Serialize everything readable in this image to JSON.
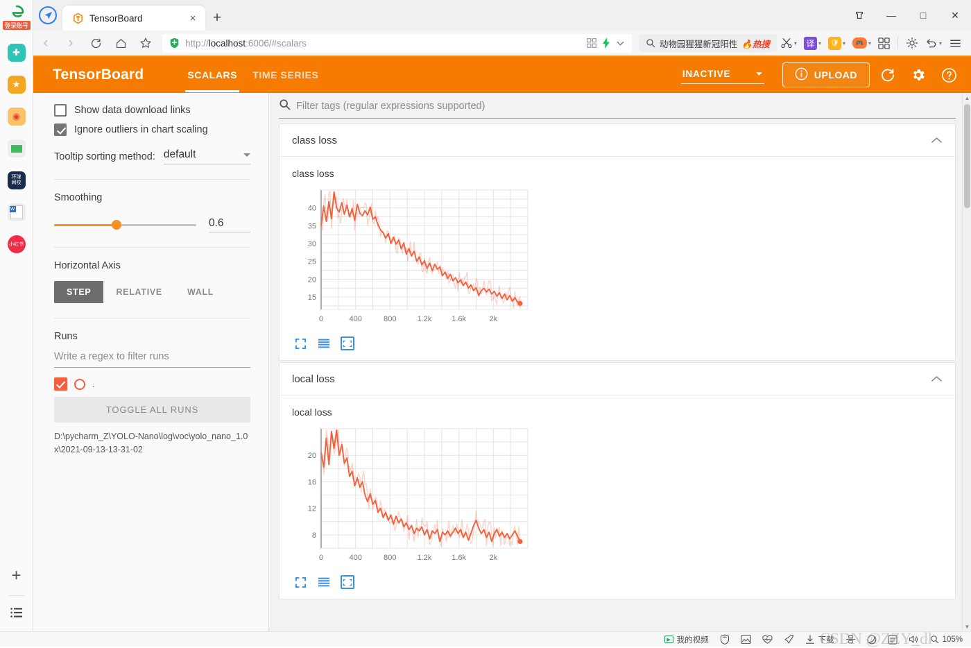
{
  "browser": {
    "tab": {
      "title": "TensorBoard",
      "favicon": "tensorboard-icon",
      "close": "×"
    },
    "newtab_label": "+",
    "window_controls": {
      "restore_group": "☆",
      "minimize": "—",
      "maximize": "□",
      "close": "✕"
    },
    "nav": {
      "back": "‹",
      "forward": "›",
      "reload": "⟳",
      "home": "⌂",
      "bookmark": "☆"
    },
    "address": {
      "scheme": "http://",
      "host": "localhost",
      "rest": ":6006/#scalars",
      "full": "http://localhost:6006/#scalars",
      "security": "shield-icon"
    },
    "omnibox_icons": [
      "qr-code-icon",
      "lightning-icon",
      "chevron-down-icon"
    ],
    "search_pill": {
      "text": "动物园猩猩新冠阳性",
      "badge": "热搜"
    },
    "toolbar_icons": [
      "scissors-icon",
      "translate-icon",
      "shield-rewards-icon",
      "game-icon",
      "apps-grid-icon",
      "brightness-icon",
      "undo-icon",
      "menu-icon"
    ],
    "rail": {
      "logo": "e-browser-logo",
      "login_tag": "登录账号",
      "items": [
        {
          "name": "app-icon-doctor",
          "glyph": "⚕",
          "bg": "#2ec4b6"
        },
        {
          "name": "app-icon-favorites",
          "glyph": "★",
          "bg": "#f5a623"
        },
        {
          "name": "app-icon-weibo",
          "glyph": "◉",
          "bg": "#fbc26a"
        },
        {
          "name": "app-icon-mail",
          "glyph": "✉",
          "bg": "#eeeeee"
        },
        {
          "name": "app-icon-global-net",
          "glyph": "环球",
          "bg": "#1b2b4b"
        },
        {
          "name": "app-icon-word-doc",
          "glyph": "W",
          "bg": "#ededed"
        },
        {
          "name": "app-icon-xiaohongshu",
          "glyph": "小红书",
          "bg": "#f42a48"
        }
      ],
      "add": "+",
      "list": "list-icon"
    },
    "statusbar": {
      "my_video": "我的视频",
      "download": "下载",
      "icons": [
        "shield-icon",
        "image-icon",
        "heart-pulse-icon",
        "rocket-icon",
        "download-icon",
        "fingerprint-icon",
        "eco-icon",
        "incognito-icon",
        "volume-icon",
        "zoom-level-icon"
      ],
      "zoom": "105%",
      "watermark": "CSDN @ZZY_dl"
    }
  },
  "tensorboard": {
    "brand": "TensorBoard",
    "tabs": [
      {
        "label": "SCALARS",
        "active": true
      },
      {
        "label": "TIME SERIES",
        "active": false
      }
    ],
    "status_select": {
      "value": "INACTIVE"
    },
    "upload_button": "UPLOAD",
    "header_icons": [
      "refresh-icon",
      "settings-gear-icon",
      "help-question-icon"
    ],
    "accent_color": "#f57c00",
    "line_color": "#f4603e",
    "sidebar": {
      "checkboxes": [
        {
          "label": "Show data download links",
          "checked": false
        },
        {
          "label": "Ignore outliers in chart scaling",
          "checked": true
        }
      ],
      "tooltip_sorting": {
        "label": "Tooltip sorting method:",
        "value": "default"
      },
      "smoothing": {
        "label": "Smoothing",
        "value": "0.6",
        "percent": 44
      },
      "horizontal_axis": {
        "label": "Horizontal Axis",
        "options": [
          {
            "label": "STEP",
            "active": true
          },
          {
            "label": "RELATIVE",
            "active": false
          },
          {
            "label": "WALL",
            "active": false
          }
        ]
      },
      "runs": {
        "label": "Runs",
        "filter_placeholder": "Write a regex to filter runs",
        "run_item_label": ".",
        "toggle_all": "TOGGLE ALL RUNS",
        "path": "D:\\pycharm_Z\\YOLO-Nano\\log\\voc\\yolo_nano_1.0x\\2021-09-13-13-31-02"
      }
    },
    "filter": {
      "placeholder": "Filter tags (regular expressions supported)",
      "icon": "search-icon"
    },
    "chart_actions": [
      "expand-fullscreen-icon",
      "toggle-y-axis-log-icon",
      "fit-domain-to-data-icon"
    ],
    "cards": [
      {
        "group_title": "class loss",
        "chart_title": "class loss",
        "collapsed": false
      },
      {
        "group_title": "local loss",
        "chart_title": "local loss",
        "collapsed": false
      }
    ]
  },
  "chart_data": [
    {
      "type": "line",
      "title": "class loss",
      "xlabel": "",
      "ylabel": "",
      "xlim": [
        0,
        2400
      ],
      "ylim": [
        11.5,
        45
      ],
      "xticks": [
        0,
        400,
        800,
        1200,
        1600,
        2000
      ],
      "xticklabels": [
        "0",
        "400",
        "800",
        "1.2k",
        "1.6k",
        "2k"
      ],
      "yticks": [
        15,
        20,
        25,
        30,
        35,
        40
      ],
      "yticklabels": [
        "15",
        "20",
        "25",
        "30",
        "35",
        "40"
      ],
      "grid": true,
      "legend": "none",
      "series": [
        {
          "name": "D:\\pycharm_Z\\YOLO-Nano\\log\\voc\\yolo_nano_1.0x\\2021-09-13-13-31-02",
          "color": "#f4603e",
          "x": [
            0,
            30,
            60,
            90,
            120,
            150,
            180,
            210,
            240,
            270,
            300,
            330,
            360,
            390,
            420,
            450,
            480,
            510,
            540,
            570,
            600,
            630,
            660,
            690,
            720,
            750,
            780,
            810,
            840,
            870,
            900,
            930,
            960,
            990,
            1020,
            1050,
            1080,
            1110,
            1140,
            1170,
            1200,
            1230,
            1260,
            1290,
            1320,
            1350,
            1380,
            1410,
            1440,
            1470,
            1500,
            1530,
            1560,
            1590,
            1620,
            1650,
            1680,
            1710,
            1740,
            1770,
            1800,
            1830,
            1860,
            1890,
            1920,
            1950,
            1980,
            2010,
            2040,
            2070,
            2100,
            2130,
            2160,
            2190,
            2220,
            2250,
            2280,
            2310
          ],
          "y": [
            35.0,
            40.5,
            36.2,
            41.8,
            37.0,
            44.5,
            40.0,
            38.8,
            41.5,
            38.2,
            40.8,
            37.5,
            39.8,
            36.5,
            41.0,
            38.5,
            37.8,
            39.2,
            38.0,
            40.2,
            36.8,
            37.5,
            35.2,
            33.8,
            33.0,
            31.5,
            32.8,
            30.0,
            31.8,
            29.8,
            31.0,
            28.5,
            30.2,
            27.0,
            28.6,
            26.5,
            27.8,
            25.0,
            26.2,
            24.0,
            25.2,
            23.0,
            24.5,
            22.4,
            24.2,
            22.8,
            23.4,
            21.0,
            22.0,
            20.2,
            21.4,
            19.5,
            20.4,
            19.0,
            19.8,
            18.2,
            19.2,
            17.5,
            18.4,
            16.8,
            17.6,
            15.4,
            16.8,
            17.4,
            16.4,
            17.2,
            15.8,
            16.6,
            15.2,
            16.2,
            14.6,
            15.8,
            14.2,
            15.4,
            13.8,
            14.8,
            13.6,
            13.2
          ]
        }
      ],
      "last_point_marker": true
    },
    {
      "type": "line",
      "title": "local loss",
      "xlabel": "",
      "ylabel": "",
      "xlim": [
        0,
        2400
      ],
      "ylim": [
        6,
        24
      ],
      "xticks": [
        0,
        400,
        800,
        1200,
        1600,
        2000
      ],
      "xticklabels": [
        "0",
        "400",
        "800",
        "1.2k",
        "1.6k",
        "2k"
      ],
      "yticks": [
        8,
        12,
        16,
        20
      ],
      "yticklabels": [
        "8",
        "12",
        "16",
        "20"
      ],
      "grid": true,
      "legend": "none",
      "series": [
        {
          "name": "D:\\pycharm_Z\\YOLO-Nano\\log\\voc\\yolo_nano_1.0x\\2021-09-13-13-31-02",
          "color": "#f4603e",
          "x": [
            0,
            30,
            60,
            90,
            120,
            150,
            180,
            210,
            240,
            270,
            300,
            330,
            360,
            390,
            420,
            450,
            480,
            510,
            540,
            570,
            600,
            630,
            660,
            690,
            720,
            750,
            780,
            810,
            840,
            870,
            900,
            930,
            960,
            990,
            1020,
            1050,
            1080,
            1110,
            1140,
            1170,
            1200,
            1230,
            1260,
            1290,
            1320,
            1350,
            1380,
            1410,
            1440,
            1470,
            1500,
            1530,
            1560,
            1590,
            1620,
            1650,
            1680,
            1710,
            1740,
            1770,
            1800,
            1830,
            1860,
            1890,
            1920,
            1950,
            1980,
            2010,
            2040,
            2070,
            2100,
            2130,
            2160,
            2190,
            2220,
            2250,
            2280,
            2310
          ],
          "y": [
            20.4,
            18.2,
            22.6,
            18.6,
            23.6,
            21.0,
            23.8,
            20.0,
            21.6,
            18.8,
            19.6,
            16.8,
            17.6,
            15.4,
            16.6,
            15.2,
            16.0,
            14.0,
            13.0,
            14.2,
            12.6,
            13.2,
            11.4,
            12.0,
            10.6,
            11.4,
            10.2,
            11.0,
            9.6,
            10.8,
            9.8,
            10.4,
            9.2,
            9.8,
            8.8,
            9.4,
            8.2,
            9.0,
            8.6,
            9.2,
            8.0,
            8.8,
            7.4,
            8.6,
            8.2,
            8.8,
            7.0,
            8.4,
            8.0,
            8.6,
            7.8,
            8.4,
            9.0,
            8.2,
            8.8,
            7.6,
            8.4,
            7.2,
            8.2,
            9.4,
            10.2,
            9.0,
            8.2,
            8.8,
            7.6,
            8.4,
            7.0,
            8.2,
            8.8,
            7.8,
            8.4,
            7.6,
            8.2,
            7.4,
            8.0,
            8.6,
            7.8,
            7.0
          ]
        }
      ],
      "last_point_marker": true
    }
  ]
}
